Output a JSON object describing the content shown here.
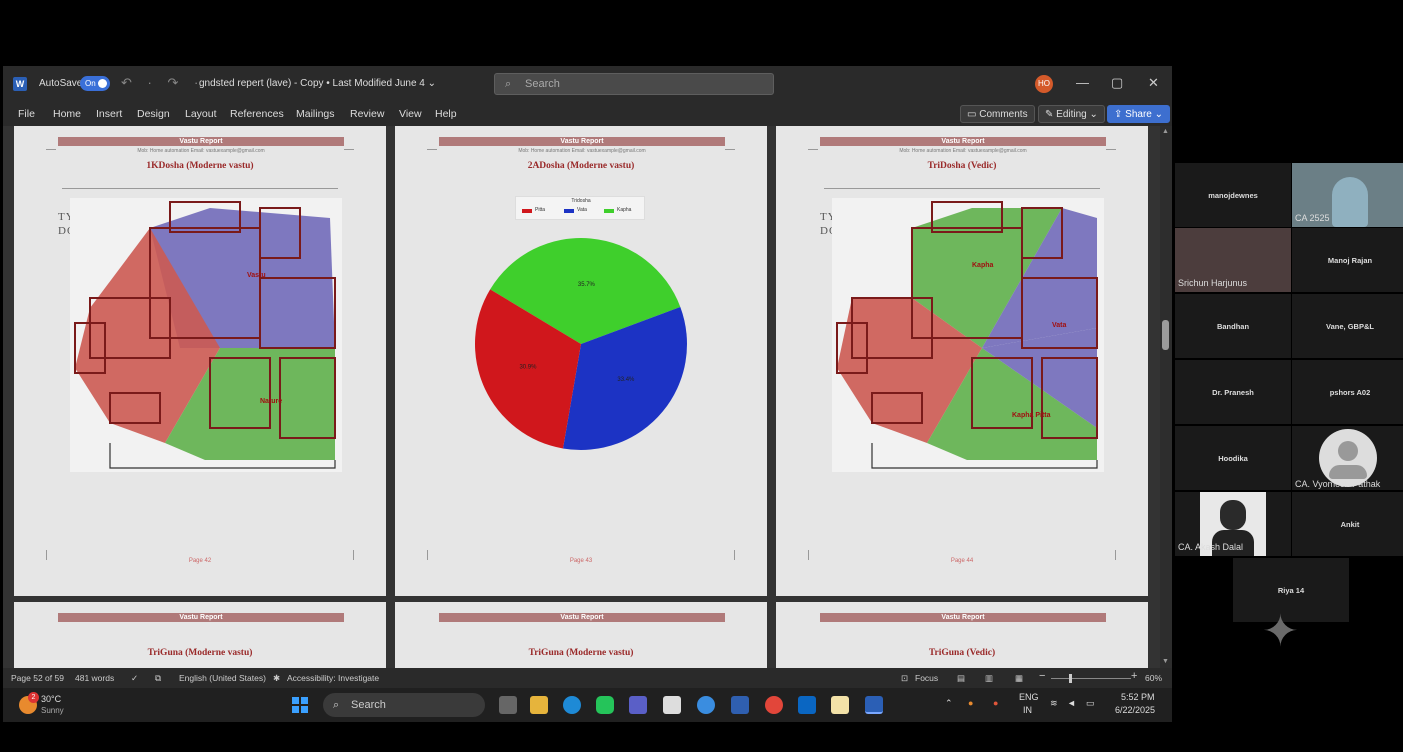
{
  "window": {
    "autosave_label": "AutoSave",
    "autosave_state": "On",
    "undo_glyphs": "↶ · ↷ ·",
    "doc_title": "gndsted repert (lave) - Copy • Last Modified June 4 ⌄",
    "search_placeholder": "Search",
    "user_initials": "HO",
    "controls": [
      "—",
      "▢",
      "✕"
    ]
  },
  "menu": {
    "items": [
      "File",
      "Home",
      "Insert",
      "Design",
      "Layout",
      "References",
      "Mailings",
      "Review",
      "View",
      "Help"
    ],
    "comments": "Comments",
    "editing": "Editing ⌄",
    "share": "Share ⌄"
  },
  "pages": [
    {
      "header": "Vastu Report",
      "sub": "Mob: Home automation Email: vastuexample@gmail.com",
      "title": "1KDosha (Moderne vastu)",
      "typical": [
        "TYPICAL",
        "DOOR PLAN"
      ],
      "labels": [
        "Vastu",
        "Nature"
      ],
      "footer": "Page 42"
    },
    {
      "header": "Vastu Report",
      "sub": "Mob: Home automation Email: vastuexample@gmail.com",
      "title": "2ADosha (Moderne vastu)",
      "legend_title": "Tridosha",
      "legend": [
        "Pitta",
        "Vata",
        "Kapha"
      ],
      "slices": [
        {
          "name": "Pitta",
          "percent": 30.9,
          "color": "#d0171c",
          "label": "30.9%"
        },
        {
          "name": "Vata",
          "percent": 33.4,
          "color": "#1c33c4",
          "label": "33.4%"
        },
        {
          "name": "Kapha",
          "percent": 35.7,
          "color": "#3fcf2c",
          "label": "35.7%"
        }
      ],
      "footer": "Page 43"
    },
    {
      "header": "Vastu Report",
      "sub": "Mob: Home automation Email: vastuexample@gmail.com",
      "title": "TriDosha (Vedic)",
      "typical": [
        "TYPICAL",
        "DOOR PLAN"
      ],
      "labels": [
        "Kapha",
        "Vata",
        "Kapha Pitta"
      ],
      "footer": "Page 44"
    }
  ],
  "pages_bottom": [
    {
      "header": "Vastu Report",
      "title": "TriGuna (Moderne vastu)"
    },
    {
      "header": "Vastu Report",
      "title": "TriGuna (Moderne vastu)"
    },
    {
      "header": "Vastu Report",
      "title": "TriGuna (Vedic)"
    }
  ],
  "status": {
    "page": "Page 52 of 59",
    "words": "481 words",
    "language": "English (United States)",
    "accessibility": "Accessibility: Investigate",
    "focus": "Focus",
    "zoom": "60%"
  },
  "taskbar": {
    "weather_temp": "30°C",
    "weather_desc": "Sunny",
    "weather_badge": "2",
    "search": "Search",
    "lang1": "ENG",
    "lang2": "IN",
    "time": "5:52 PM",
    "date": "6/22/2025"
  },
  "participants": [
    {
      "name": "manojdewnes",
      "type": "text"
    },
    {
      "name": "CA 2525",
      "type": "video"
    },
    {
      "name": "Srichun Harjunus",
      "type": "video"
    },
    {
      "name": "Manoj Rajan",
      "type": "text"
    },
    {
      "name": "Bandhan",
      "type": "text"
    },
    {
      "name": "Vane, GBP&L",
      "type": "text"
    },
    {
      "name": "Dr. Pranesh",
      "type": "text"
    },
    {
      "name": "pshors A02",
      "type": "text"
    },
    {
      "name": "Hoodika",
      "type": "text"
    },
    {
      "name": "CA. Vyomesh Pathak",
      "type": "avatar"
    },
    {
      "name": "CA. Akash Dalal",
      "type": "video"
    },
    {
      "name": "Ankit",
      "type": "text"
    },
    {
      "name": "Riya 14",
      "type": "text"
    }
  ]
}
